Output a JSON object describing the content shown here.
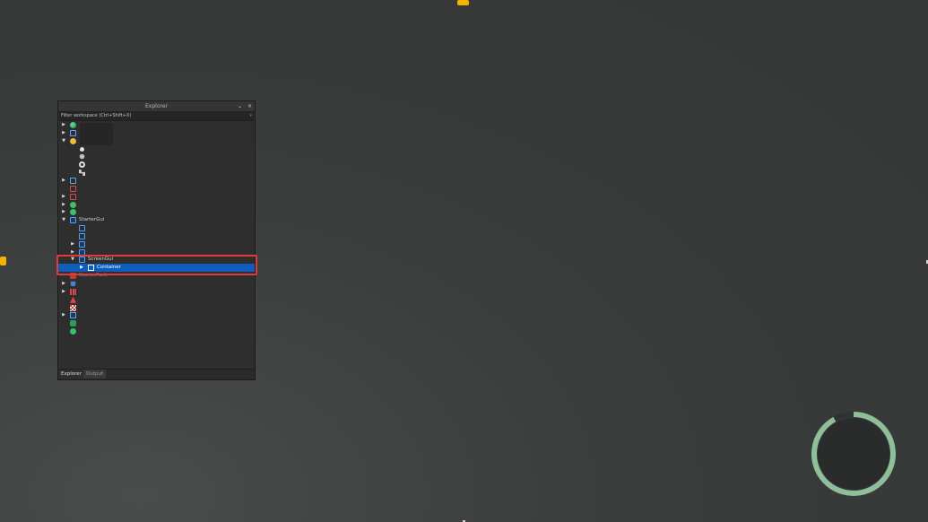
{
  "explorer": {
    "title": "Explorer",
    "controls": {
      "collapse": "⌄",
      "close": "×"
    },
    "filter_placeholder": "Filter workspace (Ctrl+Shift+X)",
    "filter_dropdown": "▾",
    "tree": [
      {
        "label": "",
        "icon": "globe-icon",
        "expanded": false,
        "has_arrow": true,
        "level": 0
      },
      {
        "label": "",
        "icon": "players-icon",
        "expanded": false,
        "has_arrow": true,
        "level": 0
      },
      {
        "label": "",
        "icon": "lighting-icon",
        "expanded": true,
        "has_arrow": true,
        "level": 0
      },
      {
        "label": "",
        "icon": "atmosphere-icon",
        "has_arrow": false,
        "level": 1
      },
      {
        "label": "",
        "icon": "clouds-icon",
        "has_arrow": false,
        "level": 1
      },
      {
        "label": "",
        "icon": "settings-icon",
        "has_arrow": false,
        "level": 1
      },
      {
        "label": "",
        "icon": "effects-icon",
        "has_arrow": false,
        "level": 1
      },
      {
        "label": "",
        "icon": "replicated-first-icon",
        "expanded": false,
        "has_arrow": true,
        "level": 0
      },
      {
        "label": "",
        "icon": "replicated-storage-icon",
        "has_arrow": false,
        "level": 0
      },
      {
        "label": "",
        "icon": "server-storage-icon",
        "expanded": false,
        "has_arrow": true,
        "level": 0
      },
      {
        "label": "",
        "icon": "server-script-service-icon",
        "expanded": false,
        "has_arrow": true,
        "level": 0
      },
      {
        "label": "",
        "icon": "starter-character-icon",
        "expanded": false,
        "has_arrow": true,
        "level": 0
      },
      {
        "label": "StarterGui",
        "icon": "starter-gui-icon",
        "expanded": true,
        "has_arrow": true,
        "level": 0
      },
      {
        "label": "",
        "icon": "local-script-icon",
        "has_arrow": false,
        "level": 1
      },
      {
        "label": "",
        "icon": "module-script-icon",
        "has_arrow": false,
        "level": 1
      },
      {
        "label": "",
        "icon": "screen-gui-icon",
        "expanded": false,
        "has_arrow": true,
        "level": 1
      },
      {
        "label": "",
        "icon": "screen-gui-icon",
        "expanded": false,
        "has_arrow": true,
        "level": 1
      },
      {
        "label": "ScreenGui",
        "icon": "screen-gui-icon",
        "expanded": true,
        "has_arrow": true,
        "level": 1
      },
      {
        "label": "Container",
        "icon": "frame-icon",
        "expanded": false,
        "has_arrow": true,
        "level": 2,
        "selected": true
      },
      {
        "label": "StarterPack",
        "icon": "starter-pack-icon",
        "has_arrow": false,
        "level": 0,
        "dim": true
      },
      {
        "label": "",
        "icon": "starter-player-icon",
        "expanded": false,
        "has_arrow": true,
        "level": 0
      },
      {
        "label": "",
        "icon": "teams-icon",
        "expanded": false,
        "has_arrow": true,
        "level": 0
      },
      {
        "label": "",
        "icon": "sound-service-icon",
        "has_arrow": false,
        "level": 0
      },
      {
        "label": "",
        "icon": "chat-icon",
        "has_arrow": false,
        "level": 0
      },
      {
        "label": "",
        "icon": "text-chat-service-icon",
        "expanded": false,
        "has_arrow": true,
        "level": 0
      },
      {
        "label": "",
        "icon": "voice-chat-icon",
        "has_arrow": false,
        "level": 0
      },
      {
        "label": "",
        "icon": "test-service-icon",
        "has_arrow": false,
        "level": 0
      }
    ],
    "tabs": [
      {
        "label": "Explorer",
        "active": true
      },
      {
        "label": "Output",
        "active": false
      }
    ]
  },
  "colors": {
    "selection": "#0e5fbd",
    "highlight_border": "#e03a3a",
    "edge_tab": "#f5b400",
    "spinner_ring": "#8fbf9a"
  },
  "loading": {
    "icon": "loading-spinner-icon",
    "progress": 0.92
  }
}
